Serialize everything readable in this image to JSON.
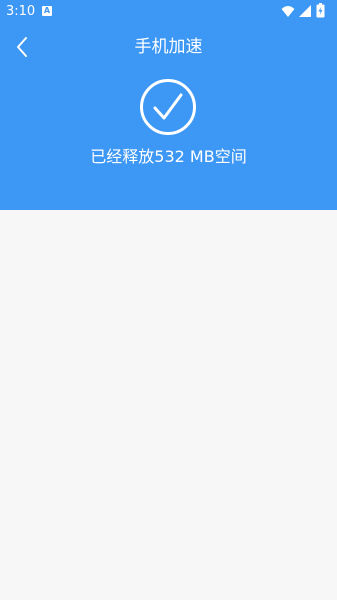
{
  "status_bar": {
    "time": "3:10",
    "app_icon_letter": "A",
    "icons": [
      "wifi-icon",
      "signal-icon",
      "battery-icon"
    ]
  },
  "header": {
    "title": "手机加速",
    "back_icon": "chevron-left-icon",
    "result_icon": "check-circle-icon",
    "result_text": "已经释放532 MB空间"
  },
  "colors": {
    "header_bg": "#3d97f5",
    "content_bg": "#f7f7f7",
    "foreground": "#ffffff"
  }
}
